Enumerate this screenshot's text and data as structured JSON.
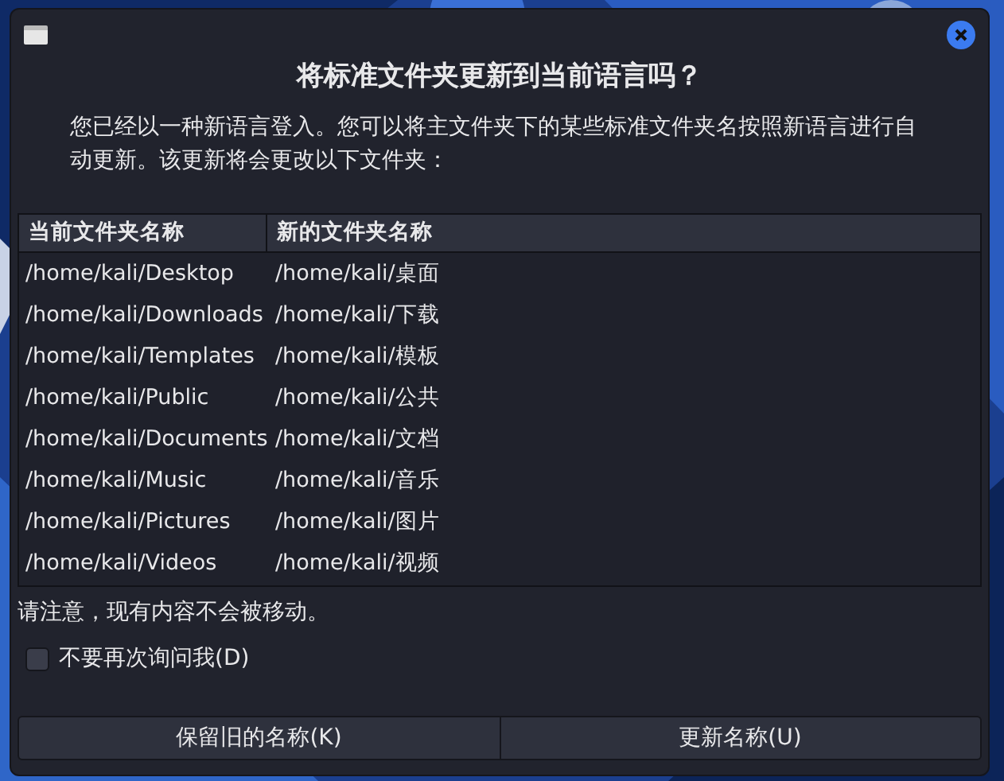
{
  "dialog": {
    "title": "将标准文件夹更新到当前语言吗？",
    "message": "您已经以一种新语言登入。您可以将主文件夹下的某些标准文件夹名按照新语言进行自动更新。该更新将会更改以下文件夹：",
    "table": {
      "columns": [
        "当前文件夹名称",
        "新的文件夹名称"
      ],
      "rows": [
        [
          "/home/kali/Desktop",
          "/home/kali/桌面"
        ],
        [
          "/home/kali/Downloads",
          "/home/kali/下载"
        ],
        [
          "/home/kali/Templates",
          "/home/kali/模板"
        ],
        [
          "/home/kali/Public",
          "/home/kali/公共"
        ],
        [
          "/home/kali/Documents",
          "/home/kali/文档"
        ],
        [
          "/home/kali/Music",
          "/home/kali/音乐"
        ],
        [
          "/home/kali/Pictures",
          "/home/kali/图片"
        ],
        [
          "/home/kali/Videos",
          "/home/kali/视频"
        ]
      ]
    },
    "note": "请注意，现有内容不会被移动。",
    "checkbox": {
      "label": "不要再次询问我(D)",
      "checked": false
    },
    "buttons": [
      "保留旧的名称(K)",
      "更新名称(U)"
    ]
  }
}
